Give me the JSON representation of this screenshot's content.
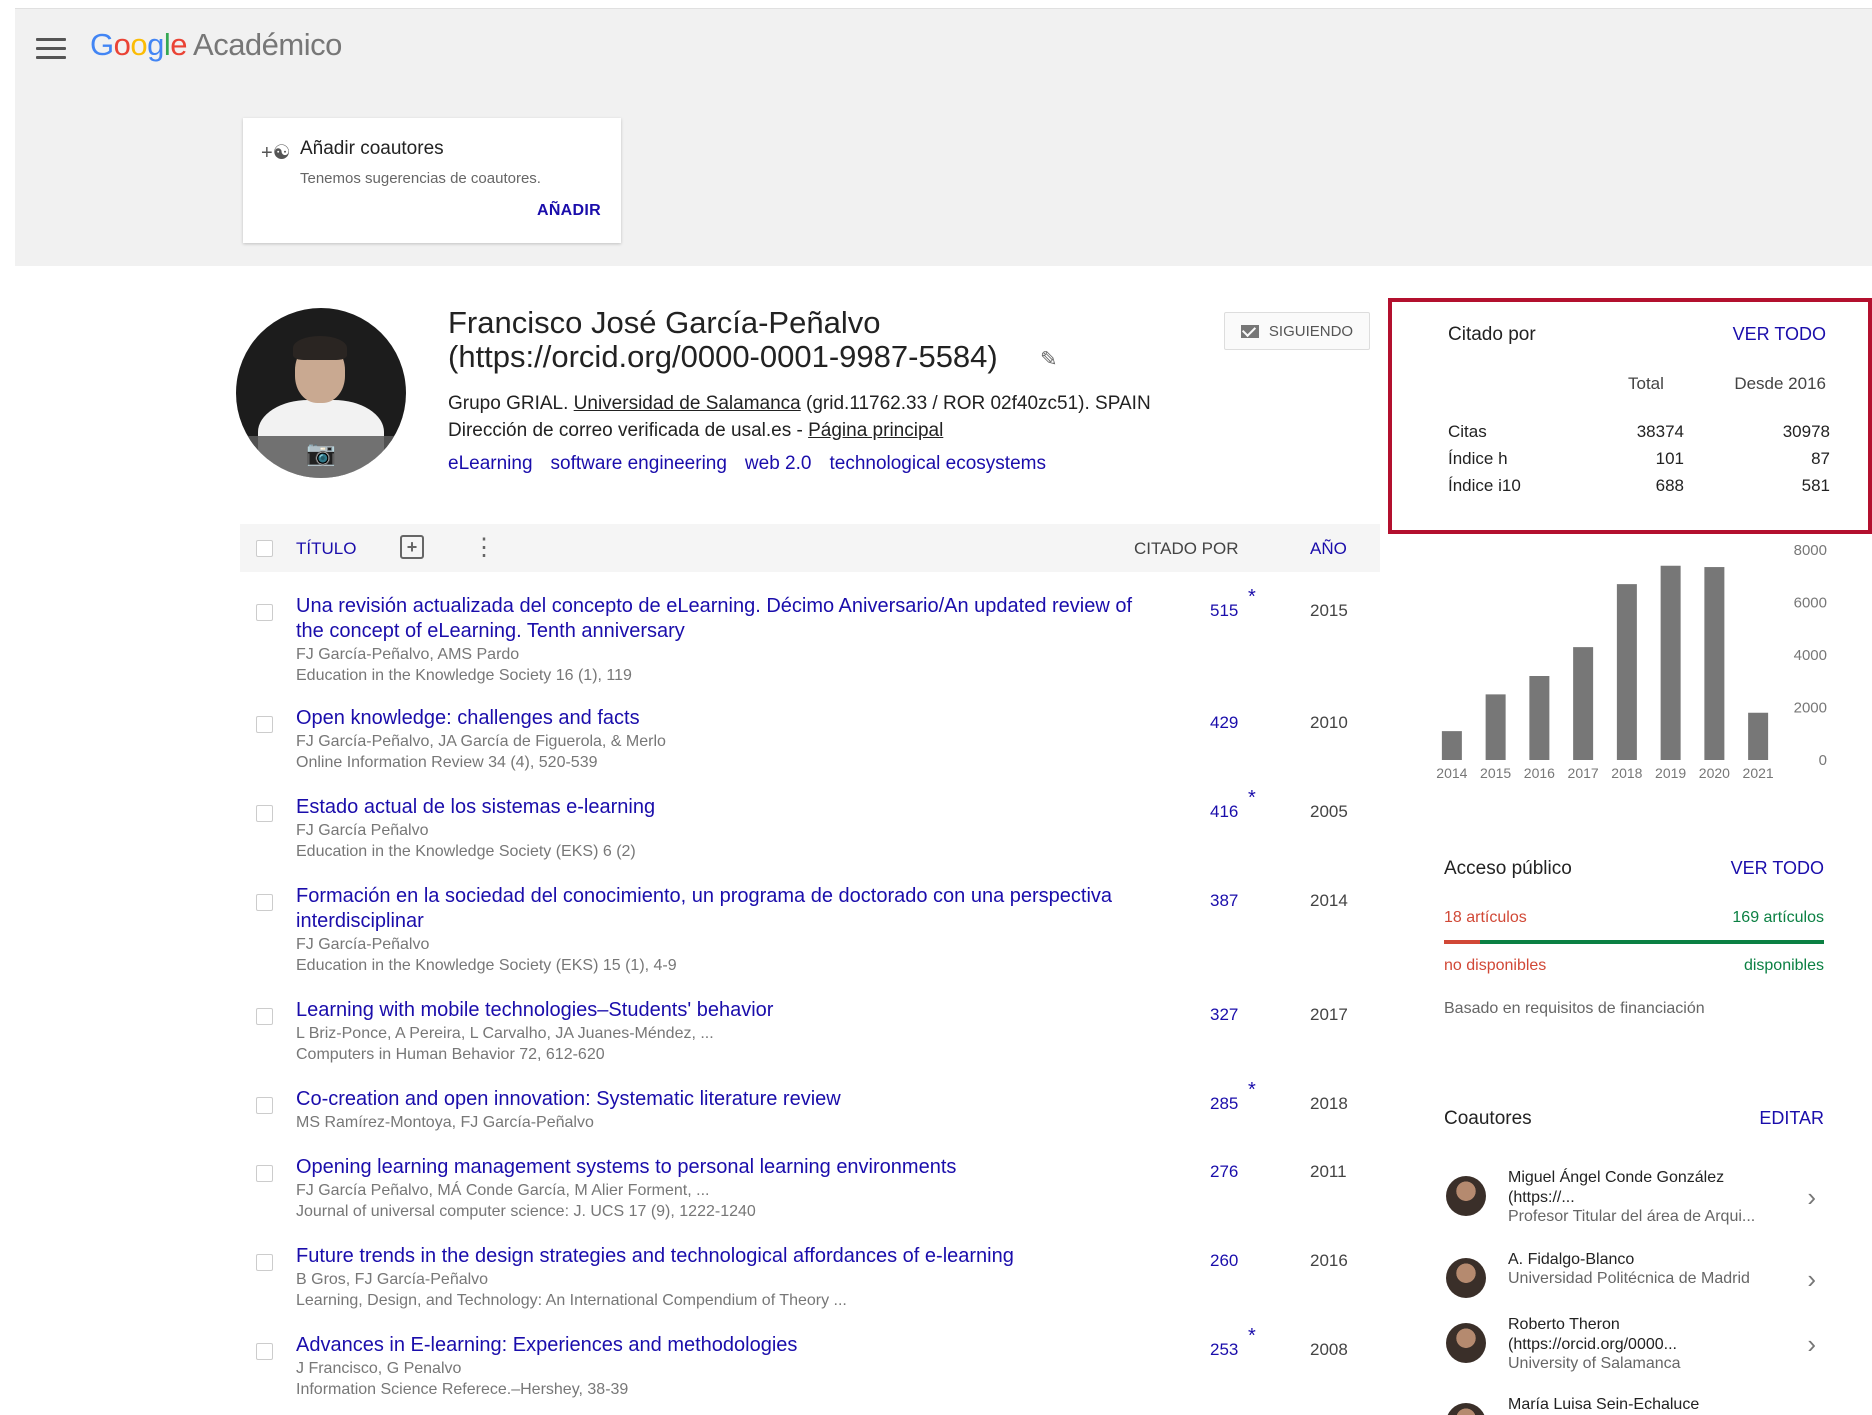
{
  "header": {
    "logo_letters": [
      "G",
      "o",
      "o",
      "g",
      "l",
      "e"
    ],
    "product": "Académico"
  },
  "suggest_card": {
    "title": "Añadir coautores",
    "subtitle": "Tenemos sugerencias de coautores.",
    "button": "AÑADIR"
  },
  "profile": {
    "name": "Francisco José García-Peñalvo (https://orcid.org/0000-0001-9987-5584)",
    "affiliation_prefix": "Grupo GRIAL. ",
    "affiliation_link": "Universidad de Salamanca",
    "affiliation_suffix": " (grid.11762.33 / ROR 02f40zc51). SPAIN",
    "email_prefix": "Dirección de correo verificada de usal.es - ",
    "homepage": "Página principal",
    "interests": [
      "eLearning",
      "software engineering",
      "web 2.0",
      "technological ecosystems"
    ],
    "follow_label": "SIGUIENDO"
  },
  "table": {
    "col_title": "TÍTULO",
    "col_cited": "CITADO POR",
    "col_year": "AÑO"
  },
  "articles": [
    {
      "title": "Una revisión actualizada del concepto de eLearning. Décimo Aniversario/An updated review of the concept of eLearning. Tenth anniversary",
      "authors": "FJ García-Peñalvo, AMS Pardo",
      "venue": "Education in the Knowledge Society 16 (1), 119",
      "cites": "515",
      "star": "*",
      "year": "2015"
    },
    {
      "title": "Open knowledge: challenges and facts",
      "authors": "FJ García-Peñalvo, JA García de Figuerola, & Merlo",
      "venue": "Online Information Review 34 (4), 520-539",
      "cites": "429",
      "star": "",
      "year": "2010"
    },
    {
      "title": "Estado actual de los sistemas e-learning",
      "authors": "FJ García Peñalvo",
      "venue": "Education in the Knowledge Society (EKS) 6 (2)",
      "cites": "416",
      "star": "*",
      "year": "2005"
    },
    {
      "title": "Formación en la sociedad del conocimiento, un programa de doctorado con una perspectiva interdisciplinar",
      "authors": "FJ García-Peñalvo",
      "venue": "Education in the Knowledge Society (EKS) 15 (1), 4-9",
      "cites": "387",
      "star": "",
      "year": "2014"
    },
    {
      "title": "Learning with mobile technologies–Students' behavior",
      "authors": "L Briz-Ponce, A Pereira, L Carvalho, JA Juanes-Méndez, ...",
      "venue": "Computers in Human Behavior 72, 612-620",
      "cites": "327",
      "star": "",
      "year": "2017"
    },
    {
      "title": "Co-creation and open innovation: Systematic literature review",
      "authors": "MS Ramírez-Montoya, FJ García-Peñalvo",
      "venue": "",
      "cites": "285",
      "star": "*",
      "year": "2018"
    },
    {
      "title": "Opening learning management systems to personal learning environments",
      "authors": "FJ García Peñalvo, MÁ Conde García, M Alier Forment, ...",
      "venue": "Journal of universal computer science: J. UCS 17 (9), 1222-1240",
      "cites": "276",
      "star": "",
      "year": "2011"
    },
    {
      "title": "Future trends in the design strategies and technological affordances of e-learning",
      "authors": "B Gros, FJ García-Peñalvo",
      "venue": "Learning, Design, and Technology: An International Compendium of Theory ...",
      "cites": "260",
      "star": "",
      "year": "2016"
    },
    {
      "title": "Advances in E-learning: Experiences and methodologies",
      "authors": "J Francisco, G Penalvo",
      "venue": "Information Science Referece.–Hershey, 38-39",
      "cites": "253",
      "star": "*",
      "year": "2008"
    }
  ],
  "cited_by": {
    "title": "Citado por",
    "view_all": "VER TODO",
    "col_total": "Total",
    "col_since": "Desde 2016",
    "rows": [
      {
        "label": "Citas",
        "total": "38374",
        "since": "30978"
      },
      {
        "label": "Índice h",
        "total": "101",
        "since": "87"
      },
      {
        "label": "Índice i10",
        "total": "688",
        "since": "581"
      }
    ]
  },
  "chart_data": {
    "type": "bar",
    "categories": [
      "2014",
      "2015",
      "2016",
      "2017",
      "2018",
      "2019",
      "2020",
      "2021"
    ],
    "values": [
      1100,
      2500,
      3200,
      4300,
      6700,
      7400,
      7350,
      1800
    ],
    "ylim": [
      0,
      8000
    ],
    "yticks": [
      "8000",
      "6000",
      "4000",
      "2000",
      "0"
    ],
    "bar_color": "#777777",
    "y_axis_position": "right"
  },
  "public_access": {
    "title": "Acceso público",
    "view_all": "VER TODO",
    "unavailable_count": "18 artículos",
    "available_count": "169 artículos",
    "unavailable_label": "no disponibles",
    "available_label": "disponibles",
    "unavailable_fraction": 0.096,
    "note": "Basado en requisitos de financiación"
  },
  "coauthors": {
    "title": "Coautores",
    "edit": "EDITAR",
    "items": [
      {
        "name": "Miguel Ángel Conde González (https://...",
        "affiliation": "Profesor Titular del área de Arqui..."
      },
      {
        "name": "A. Fidalgo-Blanco",
        "affiliation": "Universidad Politécnica de Madrid"
      },
      {
        "name": "Roberto Theron (https://orcid.org/0000...",
        "affiliation": "University of Salamanca"
      },
      {
        "name": "María Luisa Sein-Echaluce",
        "affiliation": ""
      }
    ]
  }
}
